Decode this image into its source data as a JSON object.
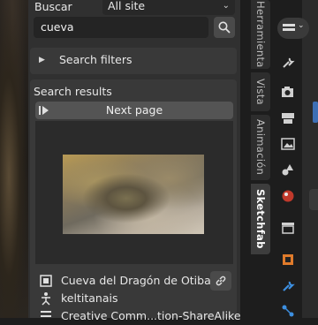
{
  "header": {
    "search_label": "Buscar",
    "scope_value": "All site"
  },
  "search": {
    "value": "cueva"
  },
  "filters": {
    "label": "Search filters"
  },
  "results": {
    "label": "Search results",
    "next_page_label": "Next page"
  },
  "model": {
    "name": "Cueva del Dragón de Otibar",
    "author": "keltitanais",
    "license": "Creative Comm...tion-ShareAlike"
  },
  "tabs": [
    {
      "label": "Herramienta"
    },
    {
      "label": "Vista"
    },
    {
      "label": "Animación"
    },
    {
      "label": "Sketchfab"
    }
  ],
  "props_icons": [
    "view-layer-icon",
    "tool-icon",
    "render-icon",
    "output-icon",
    "image-icon",
    "physics-icon",
    "world-icon",
    "collection-icon",
    "object-icon",
    "modifier-icon",
    "constraint-icon"
  ]
}
